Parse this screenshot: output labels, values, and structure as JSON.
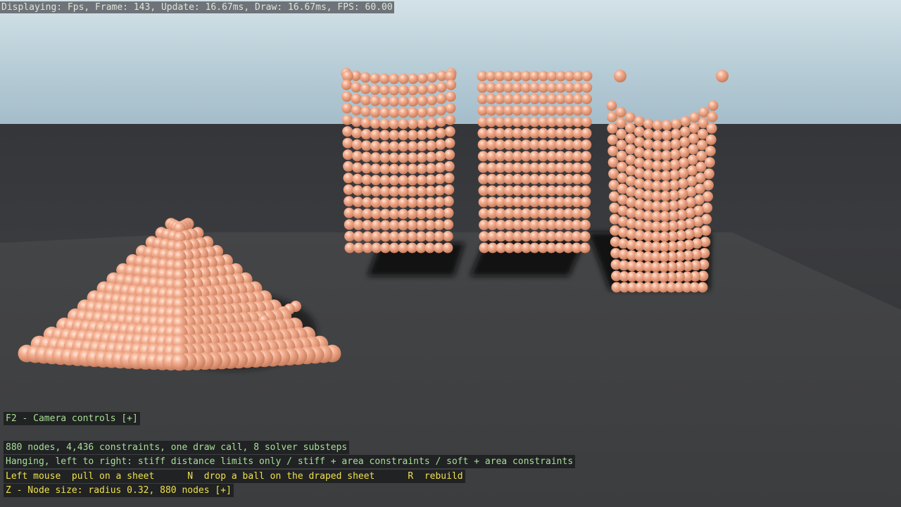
{
  "hud": {
    "stats": "Displaying: Fps, Frame: 143, Update: 16.67ms, Draw: 16.67ms, FPS: 60.00",
    "camera_controls": "F2 - Camera controls [+]",
    "info_nodes": "880 nodes, 4,436 constraints, one draw call, 8 solver substeps",
    "info_hanging": "Hanging, left to right: stiff distance limits only / stiff + area constraints / soft + area constraints",
    "controls": "Left mouse  pull on a sheet      N  drop a ball on the draped sheet      R  rebuild",
    "node_size": "Z - Node size: radius 0.32, 880 nodes [+]"
  },
  "colors": {
    "sky_top": "#cfe0e6",
    "sky_bottom": "#9fb9c7",
    "floor": "#38393b",
    "node": "#f2a887",
    "node_highlight": "#ffe3d3",
    "node_shadow": "#b86f50",
    "hud_green": "#a9df95",
    "hud_yellow": "#f0e04a"
  },
  "scene": {
    "objects": [
      "draped-sheet-on-ball",
      "sheet-stiff-distance-limits",
      "sheet-stiff-area-constraints",
      "sheet-soft-area-constraints"
    ]
  }
}
